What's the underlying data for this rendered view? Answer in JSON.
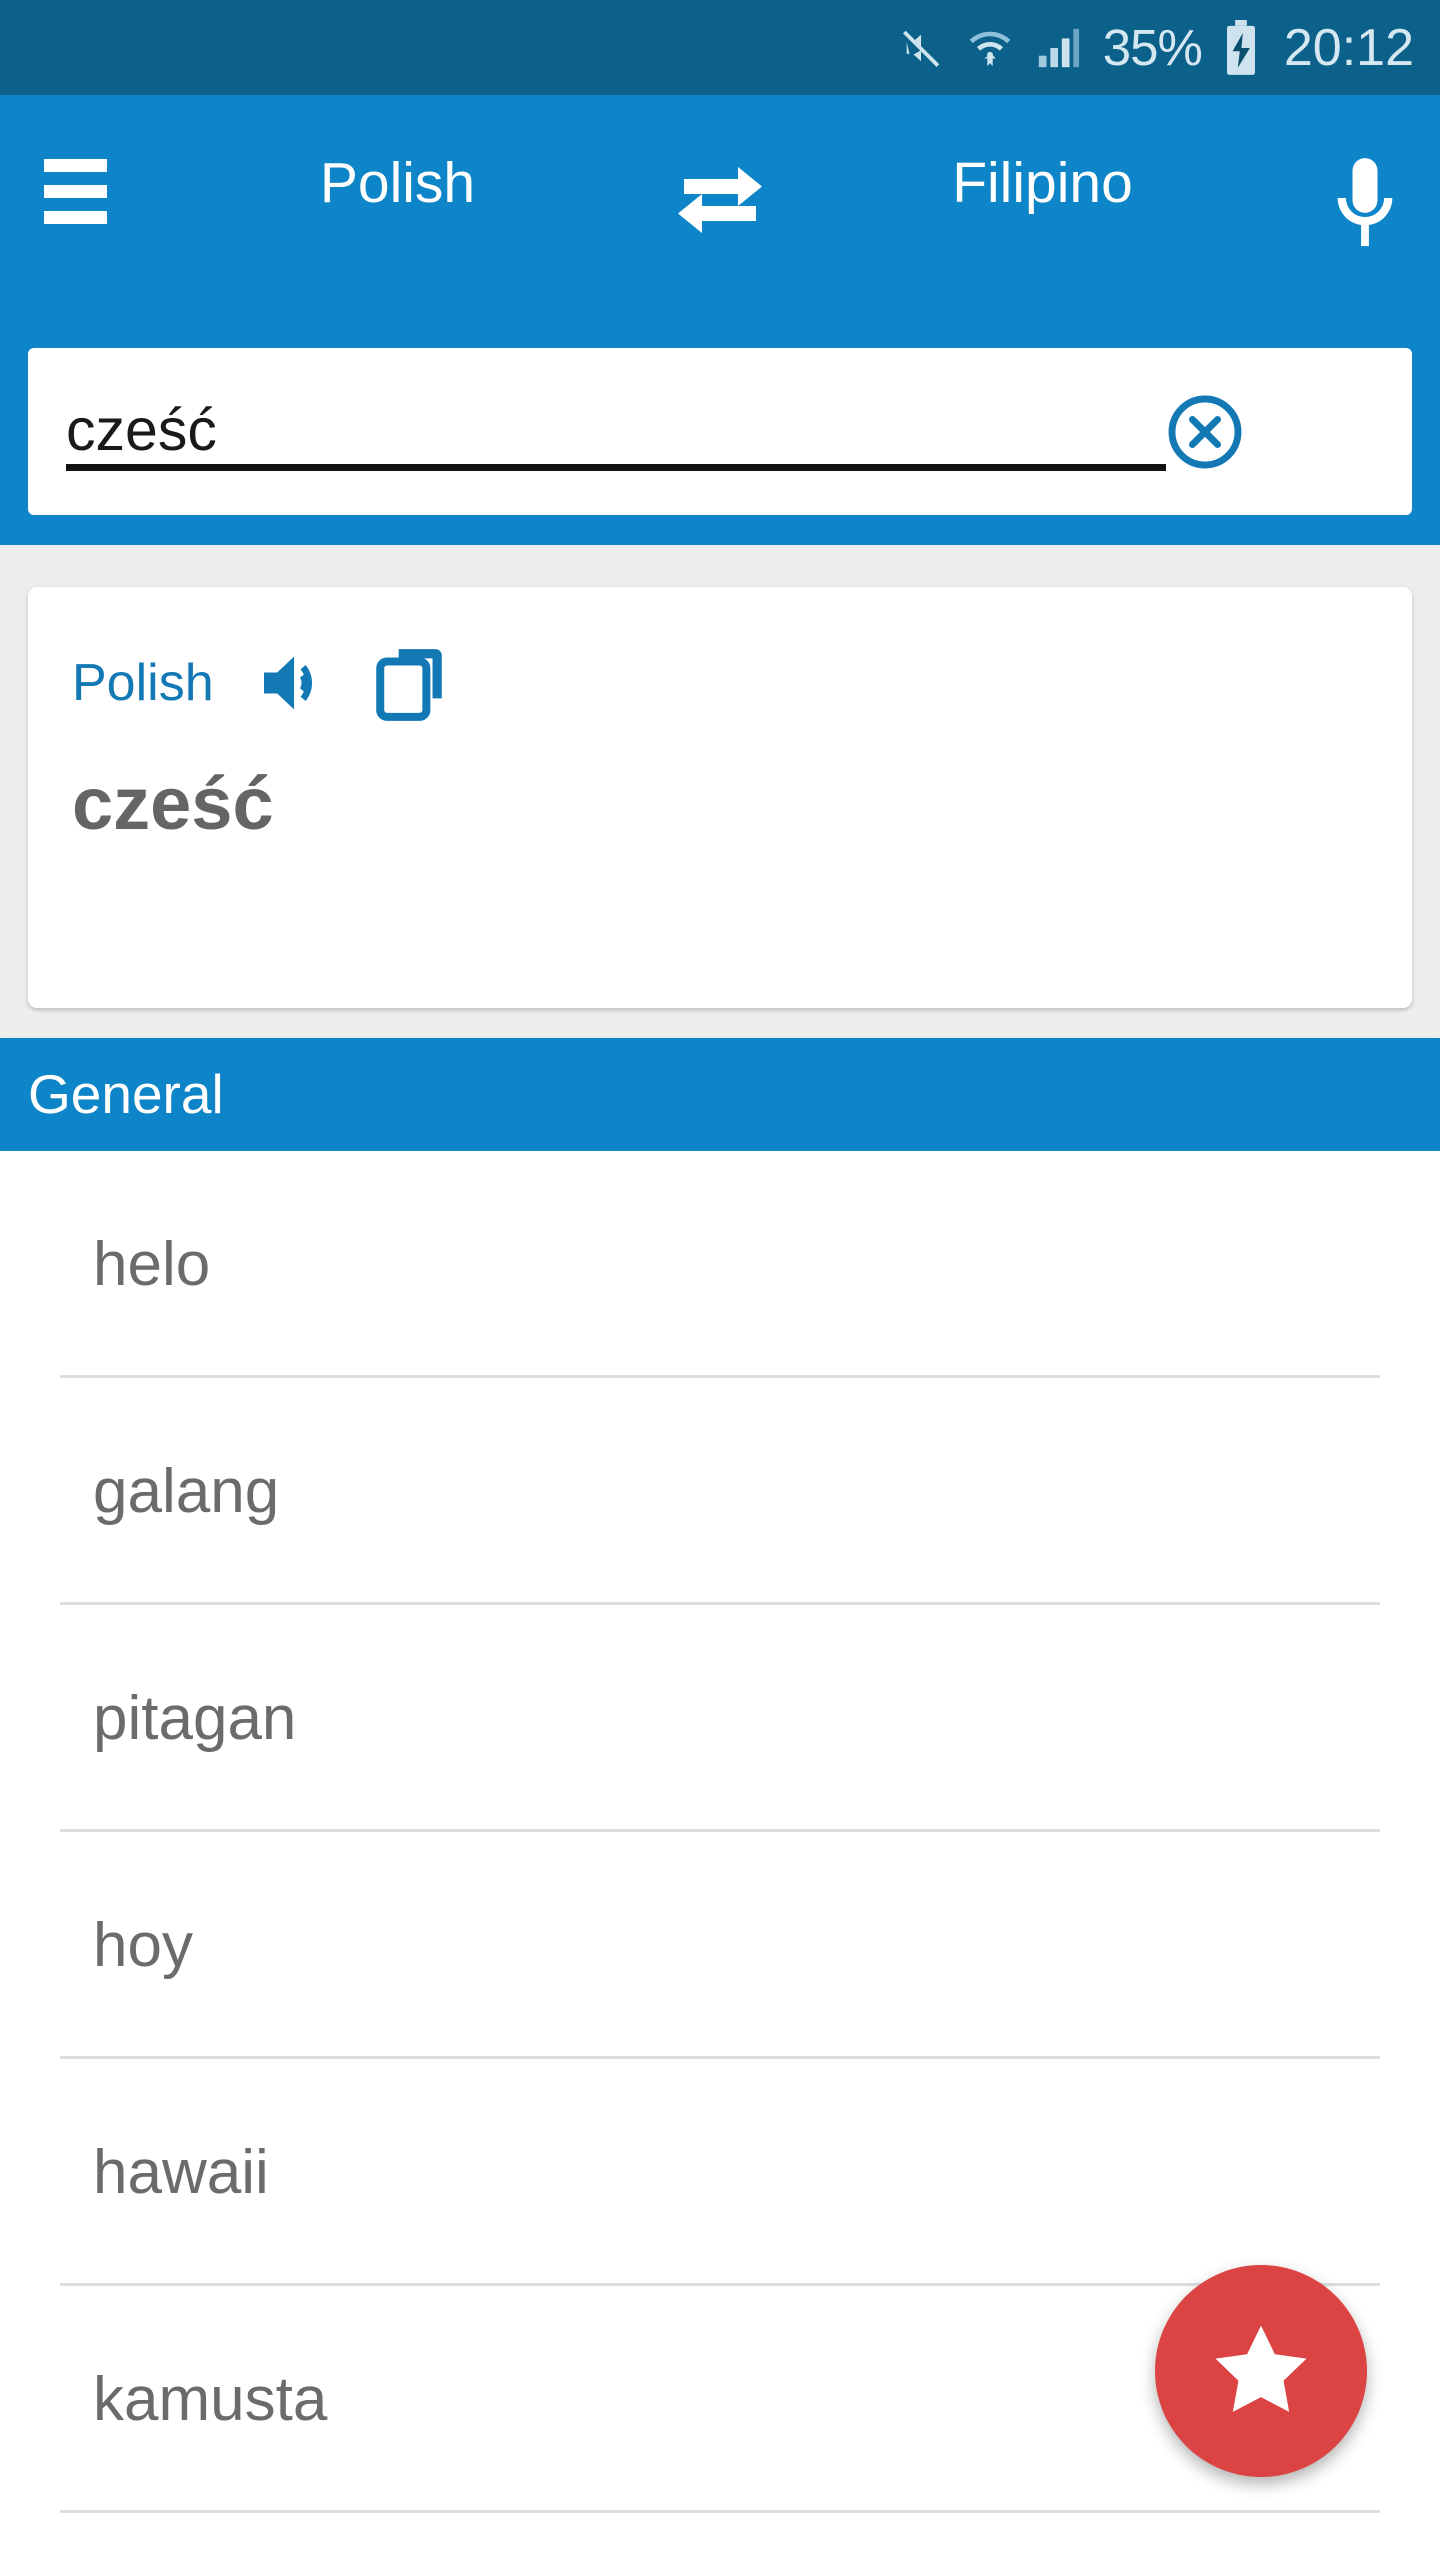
{
  "status_bar": {
    "battery_percent": "35%",
    "clock": "20:12",
    "icons": [
      "mute-icon",
      "wifi-icon",
      "signal-icon",
      "battery-charging-icon"
    ],
    "background_color": "#0b6189",
    "text_color": "#d5e7f0"
  },
  "toolbar": {
    "menu_icon": "hamburger-menu-icon",
    "source_language": "Polish",
    "swap_icon": "swap-languages-icon",
    "target_language": "Filipino",
    "mic_icon": "microphone-icon",
    "background_color": "#0d85c8"
  },
  "search": {
    "value": "cześć",
    "placeholder": "Enter text",
    "clear_icon": "clear-circle-icon"
  },
  "result_card": {
    "language_label": "Polish",
    "speaker_icon": "speaker-icon",
    "copy_icon": "copy-icon",
    "word": "cześć",
    "accent_color": "#1379b4",
    "word_color": "#656565"
  },
  "section": {
    "title": "General"
  },
  "results": [
    {
      "text": "helo"
    },
    {
      "text": "galang"
    },
    {
      "text": "pitagan"
    },
    {
      "text": "hoy"
    },
    {
      "text": "hawaii"
    },
    {
      "text": "kamusta"
    }
  ],
  "fab": {
    "icon": "star-icon",
    "color": "#dc4343"
  }
}
